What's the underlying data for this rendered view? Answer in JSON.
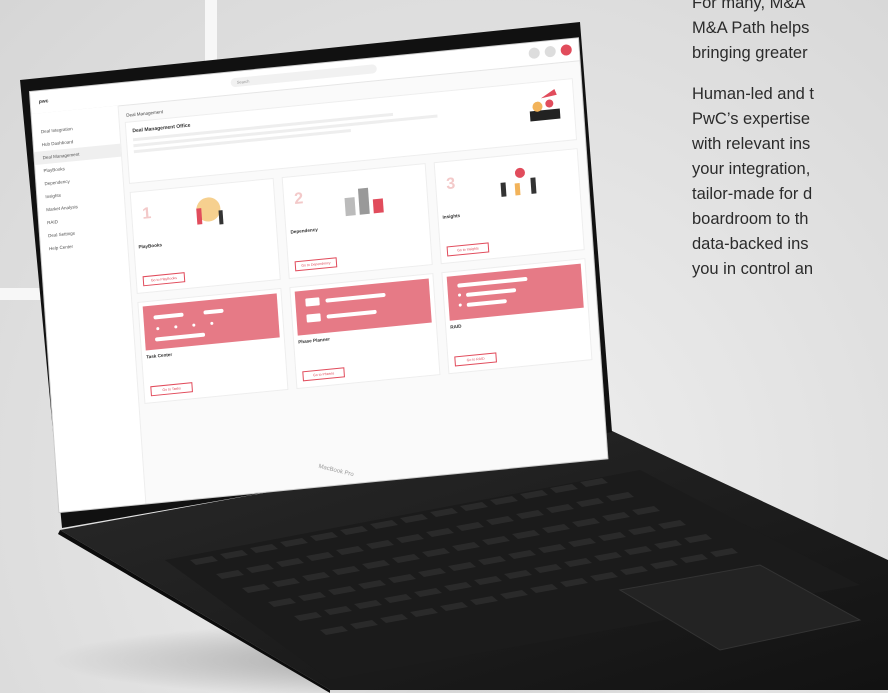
{
  "copy": {
    "p1": [
      "For many, M&A",
      "M&A Path helps",
      "bringing greater"
    ],
    "p2": [
      "Human-led and t",
      "PwC’s expertise",
      "with relevant ins",
      "your integration,",
      "tailor-made for d",
      "boardroom to th",
      "data-backed ins",
      "you in control an"
    ]
  },
  "laptop": {
    "model_label": "MacBook Pro"
  },
  "app": {
    "brand": "pwc",
    "search_placeholder": "Search",
    "sidebar": [
      "Deal Integration",
      "Hub Dashboard",
      "Deal Management",
      "PlayBooks",
      "Dependency",
      "Insights",
      "Market Analysis",
      "RAID",
      "Deal Settings",
      "Help Center"
    ],
    "tab": "Deal Management",
    "hero_title": "Deal Management Office",
    "cards": [
      {
        "num": "1",
        "title": "PlayBooks",
        "btn": "Go to PlayBooks"
      },
      {
        "num": "2",
        "title": "Dependency",
        "btn": "Go to Dependency"
      },
      {
        "num": "3",
        "title": "Insights",
        "btn": "Go to Insights"
      },
      {
        "num": "",
        "title": "Task Center",
        "btn": "Go to Tasks"
      },
      {
        "num": "",
        "title": "Phase Planner",
        "btn": "Go to Phases"
      },
      {
        "num": "",
        "title": "RAID",
        "btn": "Go to RAID"
      }
    ]
  },
  "colors": {
    "accent": "#e14c5c",
    "pink": "#e67a86",
    "laptop": "#1a1a1a",
    "bg": "#e2e2e2"
  }
}
